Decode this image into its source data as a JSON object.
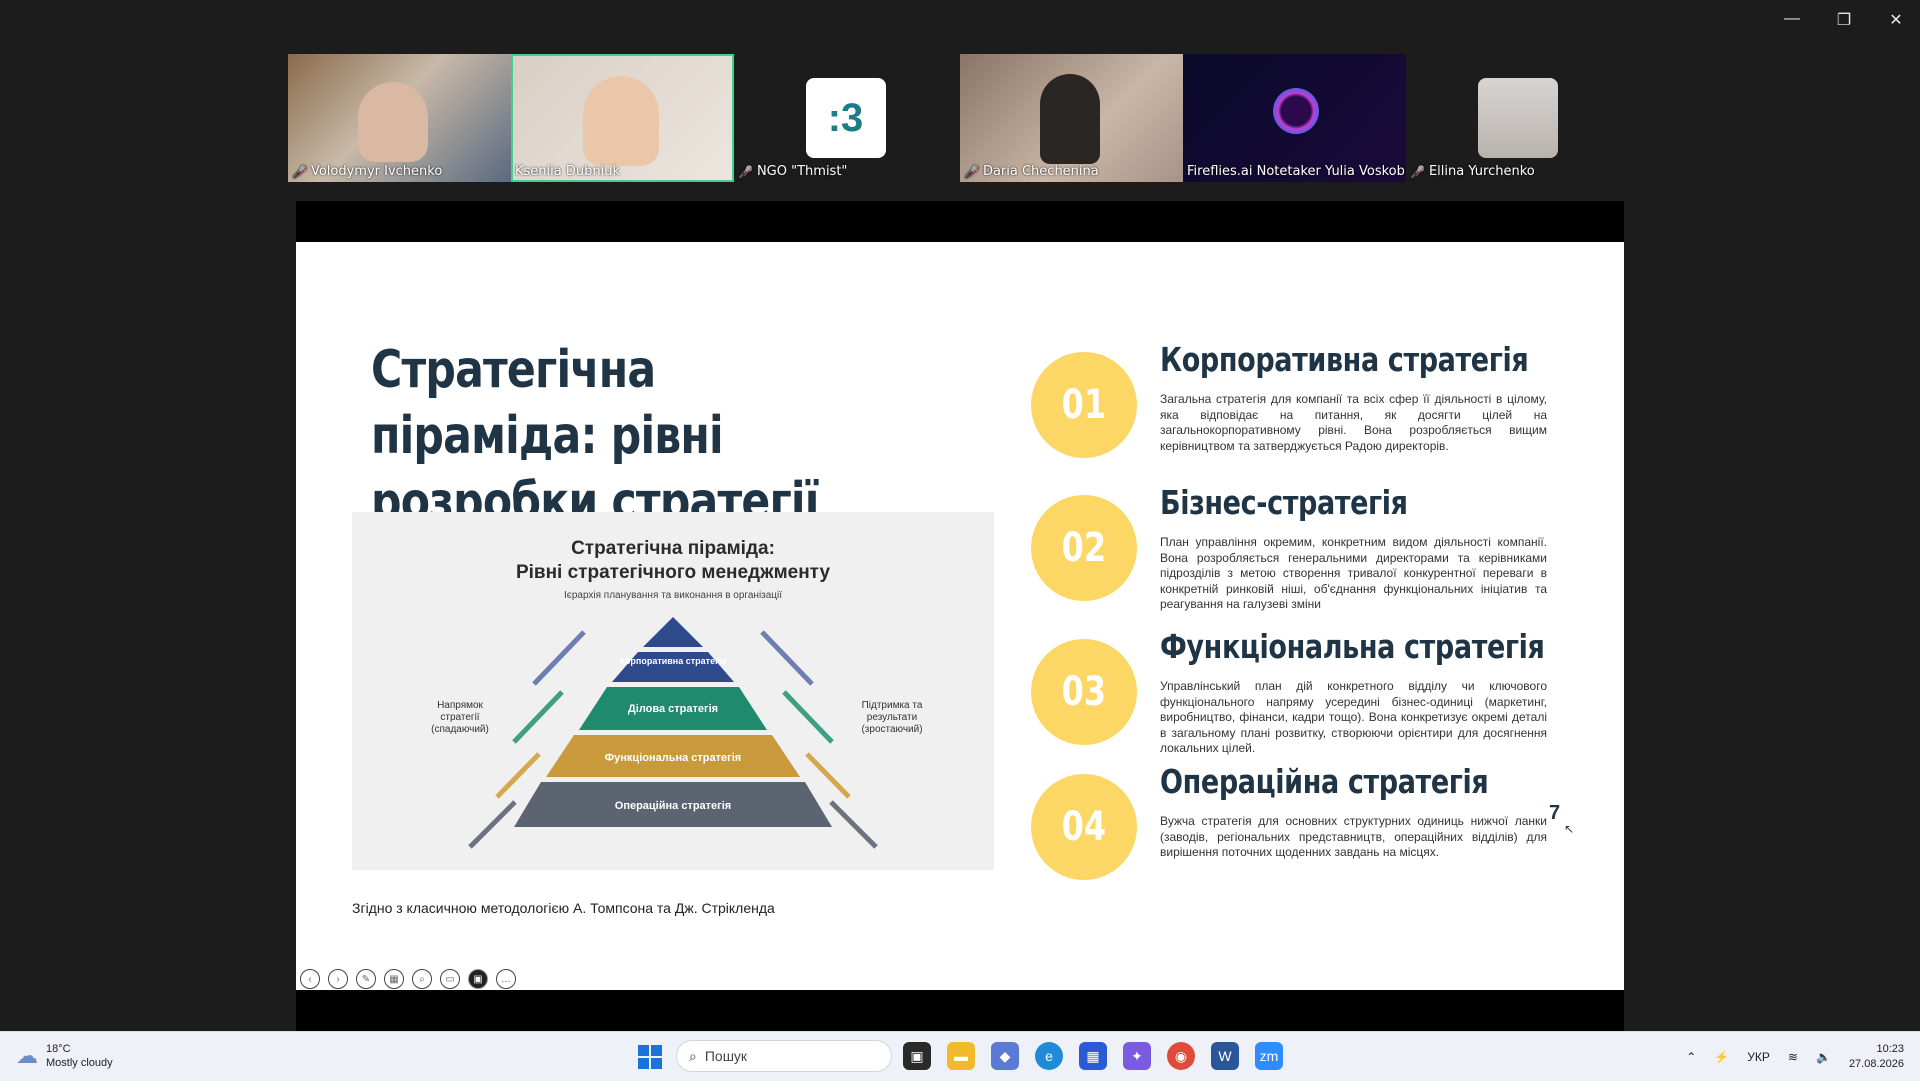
{
  "window": {
    "controls": [
      "—",
      "❐",
      "✕"
    ]
  },
  "participants": [
    {
      "name": "Volodymyr Ivchenko",
      "muted": true,
      "active": false,
      "kind": "video"
    },
    {
      "name": "Kseniia Dubniuk",
      "muted": false,
      "active": true,
      "kind": "video"
    },
    {
      "name": "NGO \"Thmist\"",
      "muted": true,
      "active": false,
      "kind": "logo",
      "logo_text": ":3"
    },
    {
      "name": "Daria Chechenina",
      "muted": true,
      "active": false,
      "kind": "video"
    },
    {
      "name": "Fireflies.ai Notetaker Yulia Voskobii...",
      "muted": false,
      "active": false,
      "kind": "bot"
    },
    {
      "name": "Ellina Yurchenko",
      "muted": true,
      "active": false,
      "kind": "photo"
    }
  ],
  "slide": {
    "title": "Стратегічна піраміда: рівні розробки стратегії",
    "image": {
      "title_line1": "Стратегічна піраміда:",
      "title_line2": "Рівні стратегічного менеджменту",
      "subtitle": "Ієрархія планування та виконання в організації",
      "left_label": "Напрямок стратегії (спадаючий)",
      "right_label": "Підтримка та результати (зростаючий)",
      "levels": [
        "Корпоративна стратегія",
        "Ділова стратегія",
        "Функціональна стратегія",
        "Операційна стратегія"
      ],
      "level_colors": [
        "#2d4a8c",
        "#1f8a6e",
        "#c99a3c",
        "#5b6470"
      ]
    },
    "footnote": "Згідно з класичною методологією А. Томпсона та Дж. Стрікленда",
    "items": [
      {
        "num": "01",
        "title": "Корпоративна стратегія",
        "desc": "Загальна стратегія для компанії та всіх сфер її діяльності в цілому, яка відповідає на питання, як досягти цілей на загальнокорпоративному рівні. Вона розробляється вищим керівництвом та затверджується Радою директорів."
      },
      {
        "num": "02",
        "title": "Бізнес-стратегія",
        "desc": "План управління окремим, конкретним видом діяльності компанії. Вона розробляється генеральними директорами та керівниками підрозділів з метою створення тривалої конкурентної переваги в конкретній ринковій ніші, об'єднання функціональних ініціатив та реагування на галузеві зміни"
      },
      {
        "num": "03",
        "title": "Функціональна стратегія",
        "desc": "Управлінський план дій конкретного відділу чи ключового функціонального напряму усередині бізнес-одиниці (маркетинг, виробництво, фінанси, кадри тощо). Вона конкретизує окремі деталі в загальному плані розвитку, створюючи орієнтири для досягнення локальних цілей."
      },
      {
        "num": "04",
        "title": "Операційна стратегія",
        "desc": "Вужча стратегія для основних структурних одиниць нижчої ланки (заводів, регіональних представництв, операційних відділів) для вирішення поточних щоденних завдань на місцях."
      }
    ],
    "page_number": "7",
    "badge_color": "#fcd765",
    "title_color": "#1f3445"
  },
  "taskbar": {
    "weather": {
      "temp": "18°C",
      "condition": "Mostly cloudy"
    },
    "search_placeholder": "Пошук",
    "lang": "УКР",
    "time": "10:23",
    "date": "27.08.2026"
  }
}
